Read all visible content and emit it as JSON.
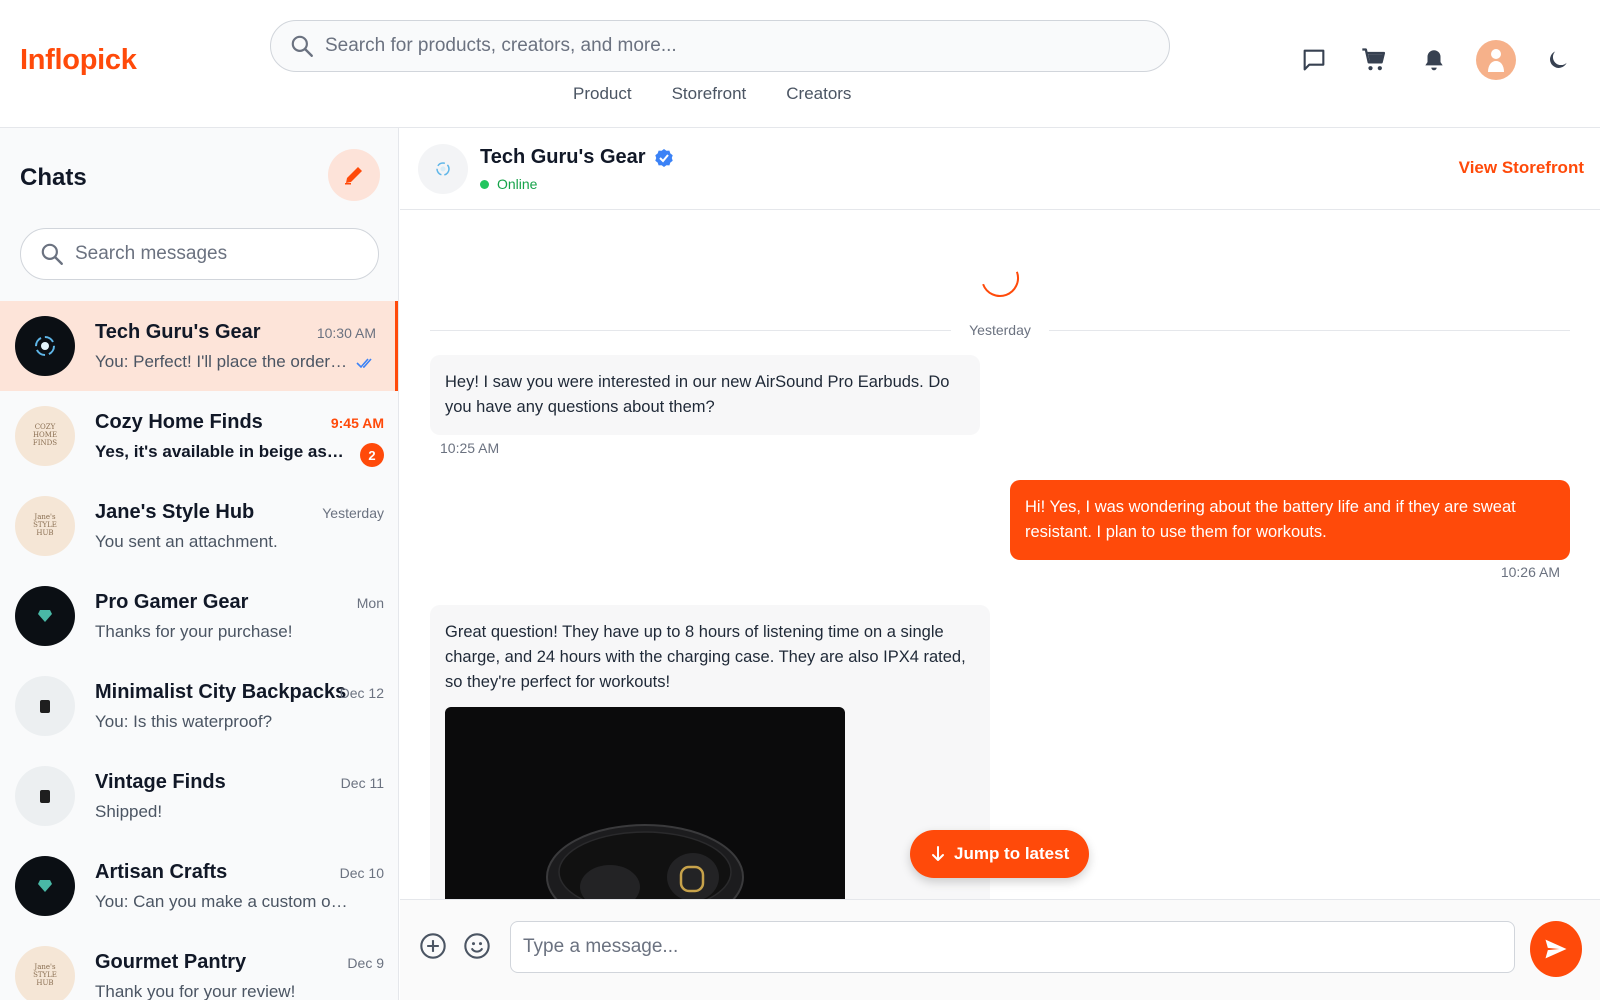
{
  "header": {
    "logo": "Inflopick",
    "search_placeholder": "Search for products, creators, and more...",
    "nav": [
      "Product",
      "Storefront",
      "Creators"
    ],
    "icons": [
      "chat-icon",
      "cart-icon",
      "bell-icon",
      "user-avatar",
      "moon-icon"
    ]
  },
  "sidebar": {
    "title": "Chats",
    "search_placeholder": "Search messages",
    "chats": [
      {
        "name": "Tech Guru's Gear",
        "time": "10:30 AM",
        "preview": "You: Perfect! I'll place the order now.",
        "active": true,
        "read": true
      },
      {
        "name": "Cozy Home Finds",
        "time": "9:45 AM",
        "preview": "Yes, it's available in beige as well!",
        "unread": "2",
        "avatar_text": "COZY HOME FINDS"
      },
      {
        "name": "Jane's Style Hub",
        "time": "Yesterday",
        "preview": "You sent an attachment.",
        "avatar_text": "Jane's STYLE HUB"
      },
      {
        "name": "Pro Gamer Gear",
        "time": "Mon",
        "preview": "Thanks for your purchase!"
      },
      {
        "name": "Minimalist City Backpacks",
        "time": "Dec 12",
        "preview": "You: Is this waterproof?"
      },
      {
        "name": "Vintage Finds",
        "time": "Dec 11",
        "preview": "Shipped!"
      },
      {
        "name": "Artisan Crafts",
        "time": "Dec 10",
        "preview": "You: Can you make a custom one?"
      },
      {
        "name": "Gourmet Pantry",
        "time": "Dec 9",
        "preview": "Thank you for your review!",
        "avatar_text": "Jane's STYLE HUB"
      }
    ]
  },
  "chat": {
    "name": "Tech Guru's Gear",
    "status": "Online",
    "view_storefront": "View Storefront",
    "date_divider": "Yesterday",
    "messages": [
      {
        "from": "them",
        "text": "Hey! I saw you were interested in our new AirSound Pro Earbuds. Do you have any questions about them?",
        "time": "10:25 AM"
      },
      {
        "from": "me",
        "text": "Hi! Yes, I was wondering about the battery life and if they are sweat resistant. I plan to use them for workouts.",
        "time": "10:26 AM"
      },
      {
        "from": "them",
        "text": "Great question! They have up to 8 hours of listening time on a single charge, and 24 hours with the charging case. They are also IPX4 rated, so they're perfect for workouts!"
      }
    ],
    "jump_label": "Jump to latest",
    "input_placeholder": "Type a message..."
  },
  "colors": {
    "accent": "#ff4a0a",
    "online": "#22c55e",
    "verified": "#3b82f6"
  }
}
